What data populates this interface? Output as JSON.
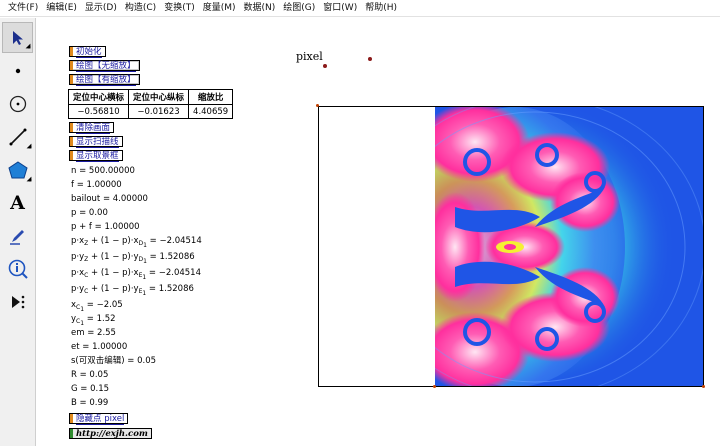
{
  "menu": [
    "文件(F)",
    "编辑(E)",
    "显示(D)",
    "构造(C)",
    "变换(T)",
    "度量(M)",
    "数据(N)",
    "绘图(G)",
    "窗口(W)",
    "帮助(H)"
  ],
  "tools": [
    "arrow-select-icon",
    "point-icon",
    "compass-icon",
    "line-icon",
    "polygon-icon",
    "text-icon",
    "marker-icon",
    "info-icon",
    "custom-tool-icon"
  ],
  "tool_text_glyph": "A",
  "buttons": {
    "init": "初始化",
    "plot_no_zoom": "绘图【无缩放】",
    "plot_zoom": "绘图【有缩放】",
    "clear": "清除画面",
    "show_scanline": "显示扫描线",
    "show_view": "显示取景框",
    "hide_pixel": "隐藏点 pixel",
    "link": "http://exjh.com"
  },
  "table": {
    "headers": [
      "定位中心横标",
      "定位中心纵标",
      "缩放比"
    ],
    "row": [
      "−0.56810",
      "−0.01623",
      "4.40659"
    ]
  },
  "measurements": {
    "n": "n = 500.00000",
    "f": "f = 1.00000",
    "bailout": "bailout = 4.00000",
    "p": "p = 0.00",
    "pf": "p + f = 1.00000",
    "xz_pre": "p·x",
    "xz_mid": " + (1 − p)·x",
    "xz_val": " = −2.04514",
    "yz_pre": "p·y",
    "yz_mid": " + (1 − p)·y",
    "yz_val": " = 1.52086",
    "xc_pre": "p·x",
    "xc_mid": " + (1 − p)·x",
    "xc_val": " = −2.04514",
    "yc_pre": "p·y",
    "yc_mid": " + (1 − p)·y",
    "yc_val": " = 1.52086",
    "xc1_pre": "x",
    "xc1_val": " = −2.05",
    "yc1_pre": "y",
    "yc1_val": " = 1.52",
    "sub_z": "Z",
    "sub_c": "C",
    "sub_d1": "D",
    "sub_e1": "E",
    "sub_1": "1",
    "em": "em = 2.55",
    "et": "et = 1.00000",
    "s": "s(可双击编辑) = 0.05",
    "R": "R = 0.05",
    "G": "G = 0.15",
    "B": "B = 0.99"
  },
  "pixel_label": "pixel",
  "colors": {
    "fractal_blue": "#1f55e6",
    "fractal_cyan": "#39d6e8",
    "fractal_pink": "#ff2f9e",
    "fractal_white": "#ffe6f3"
  }
}
